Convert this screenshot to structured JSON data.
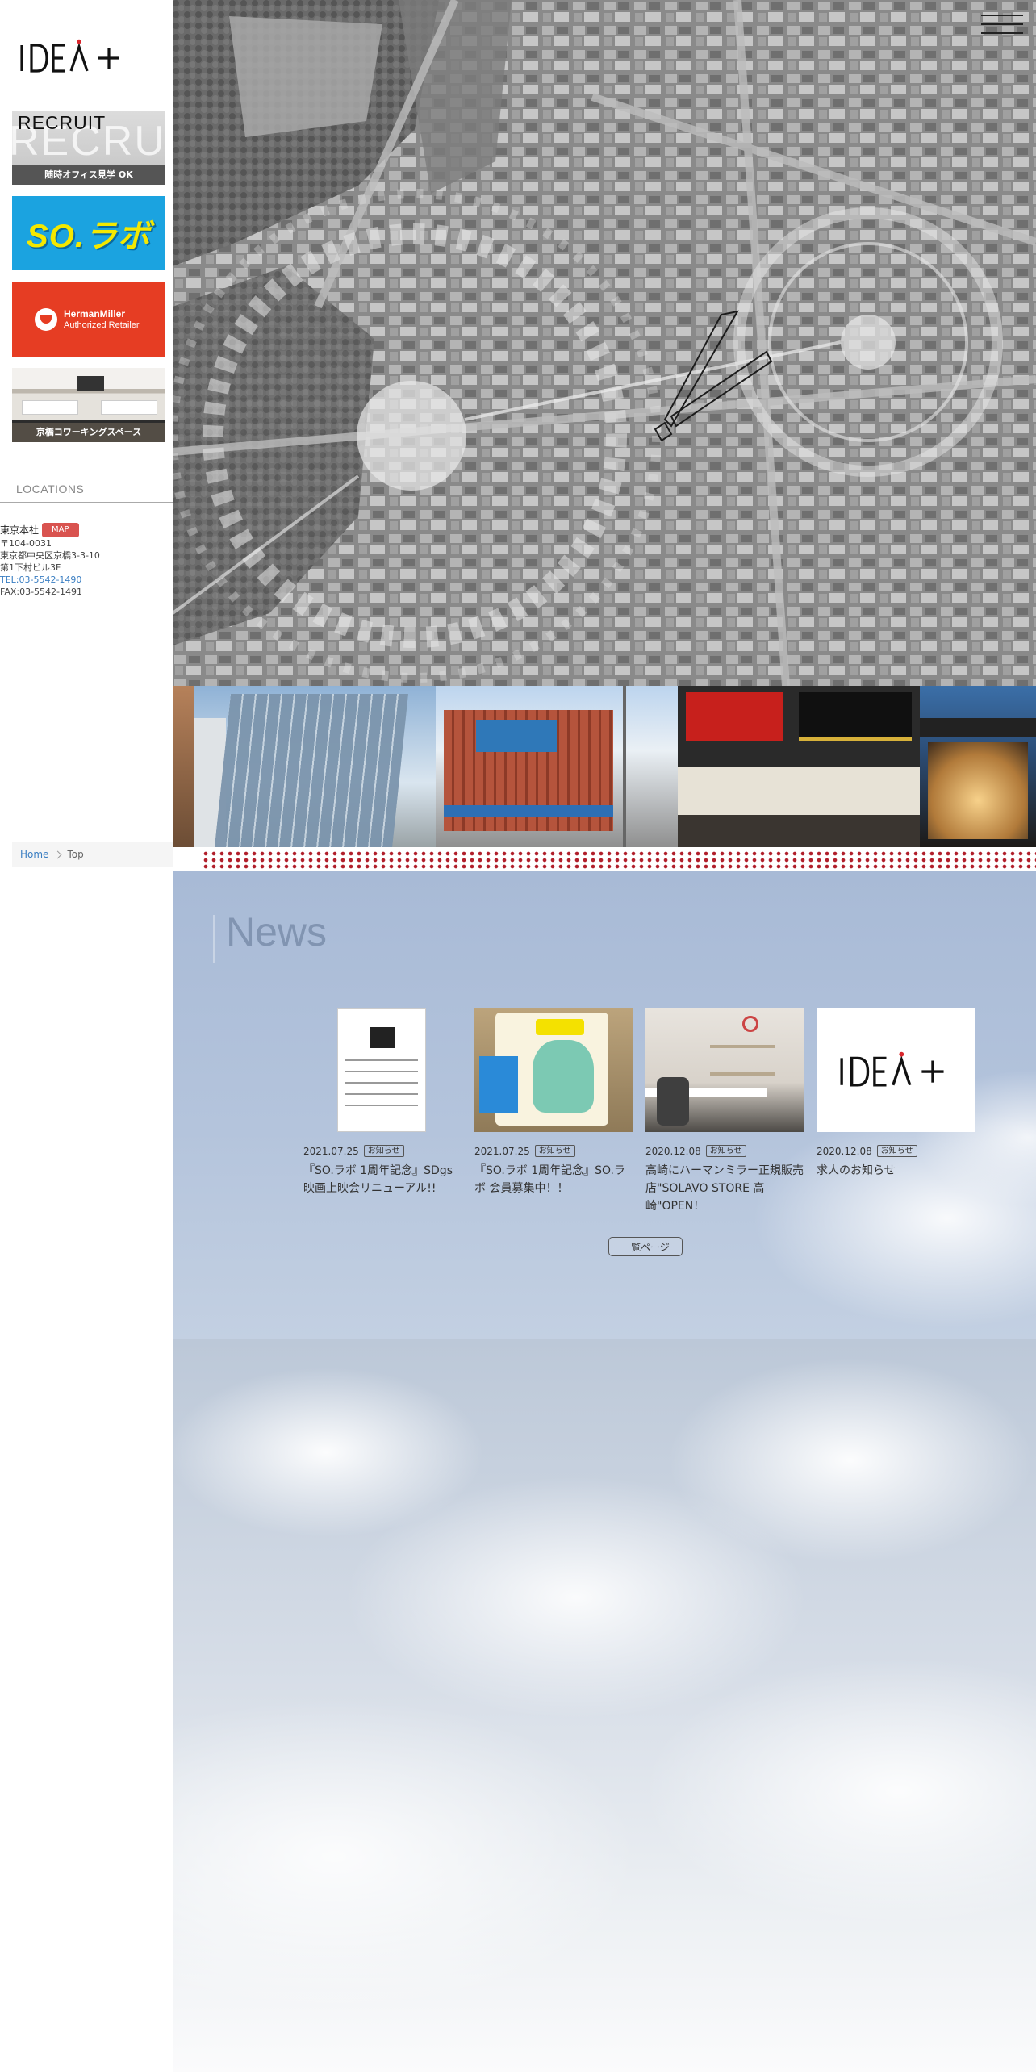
{
  "brand": {
    "logo_text": "IDEA+"
  },
  "sidebar": {
    "banners": [
      {
        "id": "recruit",
        "title": "RECRUIT",
        "ghost": "RECRUIT",
        "caption": "随時オフィス見学 OK"
      },
      {
        "id": "solabo",
        "title": "SO.ラボ"
      },
      {
        "id": "hermanmiller",
        "line1": "HermanMiller",
        "line2": "Authorized Retailer"
      },
      {
        "id": "coworking",
        "caption": "京橋コワーキングスペース"
      }
    ],
    "locations": {
      "heading": "LOCATIONS",
      "office": {
        "name": "東京本社",
        "map_label": "MAP",
        "postal": "〒104-0031",
        "address1": "東京都中央区京橋3-3-10",
        "address2": "第1下村ビル3F",
        "tel": "TEL:03-5542-1490",
        "fax": "FAX:03-5542-1491"
      }
    }
  },
  "breadcrumb": {
    "home": "Home",
    "current": "Top"
  },
  "news": {
    "title": "News",
    "more_label": "一覧ページ",
    "items": [
      {
        "date": "2021.07.25",
        "tag": "お知らせ",
        "headline": "『SO.ラボ 1周年記念』SDgs映画上映会リニューアル!!"
      },
      {
        "date": "2021.07.25",
        "tag": "お知らせ",
        "headline": "『SO.ラボ 1周年記念』SO.ラボ 会員募集中！！"
      },
      {
        "date": "2020.12.08",
        "tag": "お知らせ",
        "headline": "高崎にハーマンミラー正規販売店\"SOLAVO STORE 高崎\"OPEN！"
      },
      {
        "date": "2020.12.08",
        "tag": "お知らせ",
        "headline": "求人のお知らせ"
      }
    ]
  },
  "colors": {
    "accent_red": "#d9534f",
    "link_blue": "#3a7ec2",
    "dots_red": "#b11f2b",
    "solabo_blue": "#1ba3e0",
    "hm_red": "#e63d23"
  },
  "icons": {
    "menu": "hamburger-icon",
    "breadcrumb_separator": "chevron-right-icon"
  }
}
